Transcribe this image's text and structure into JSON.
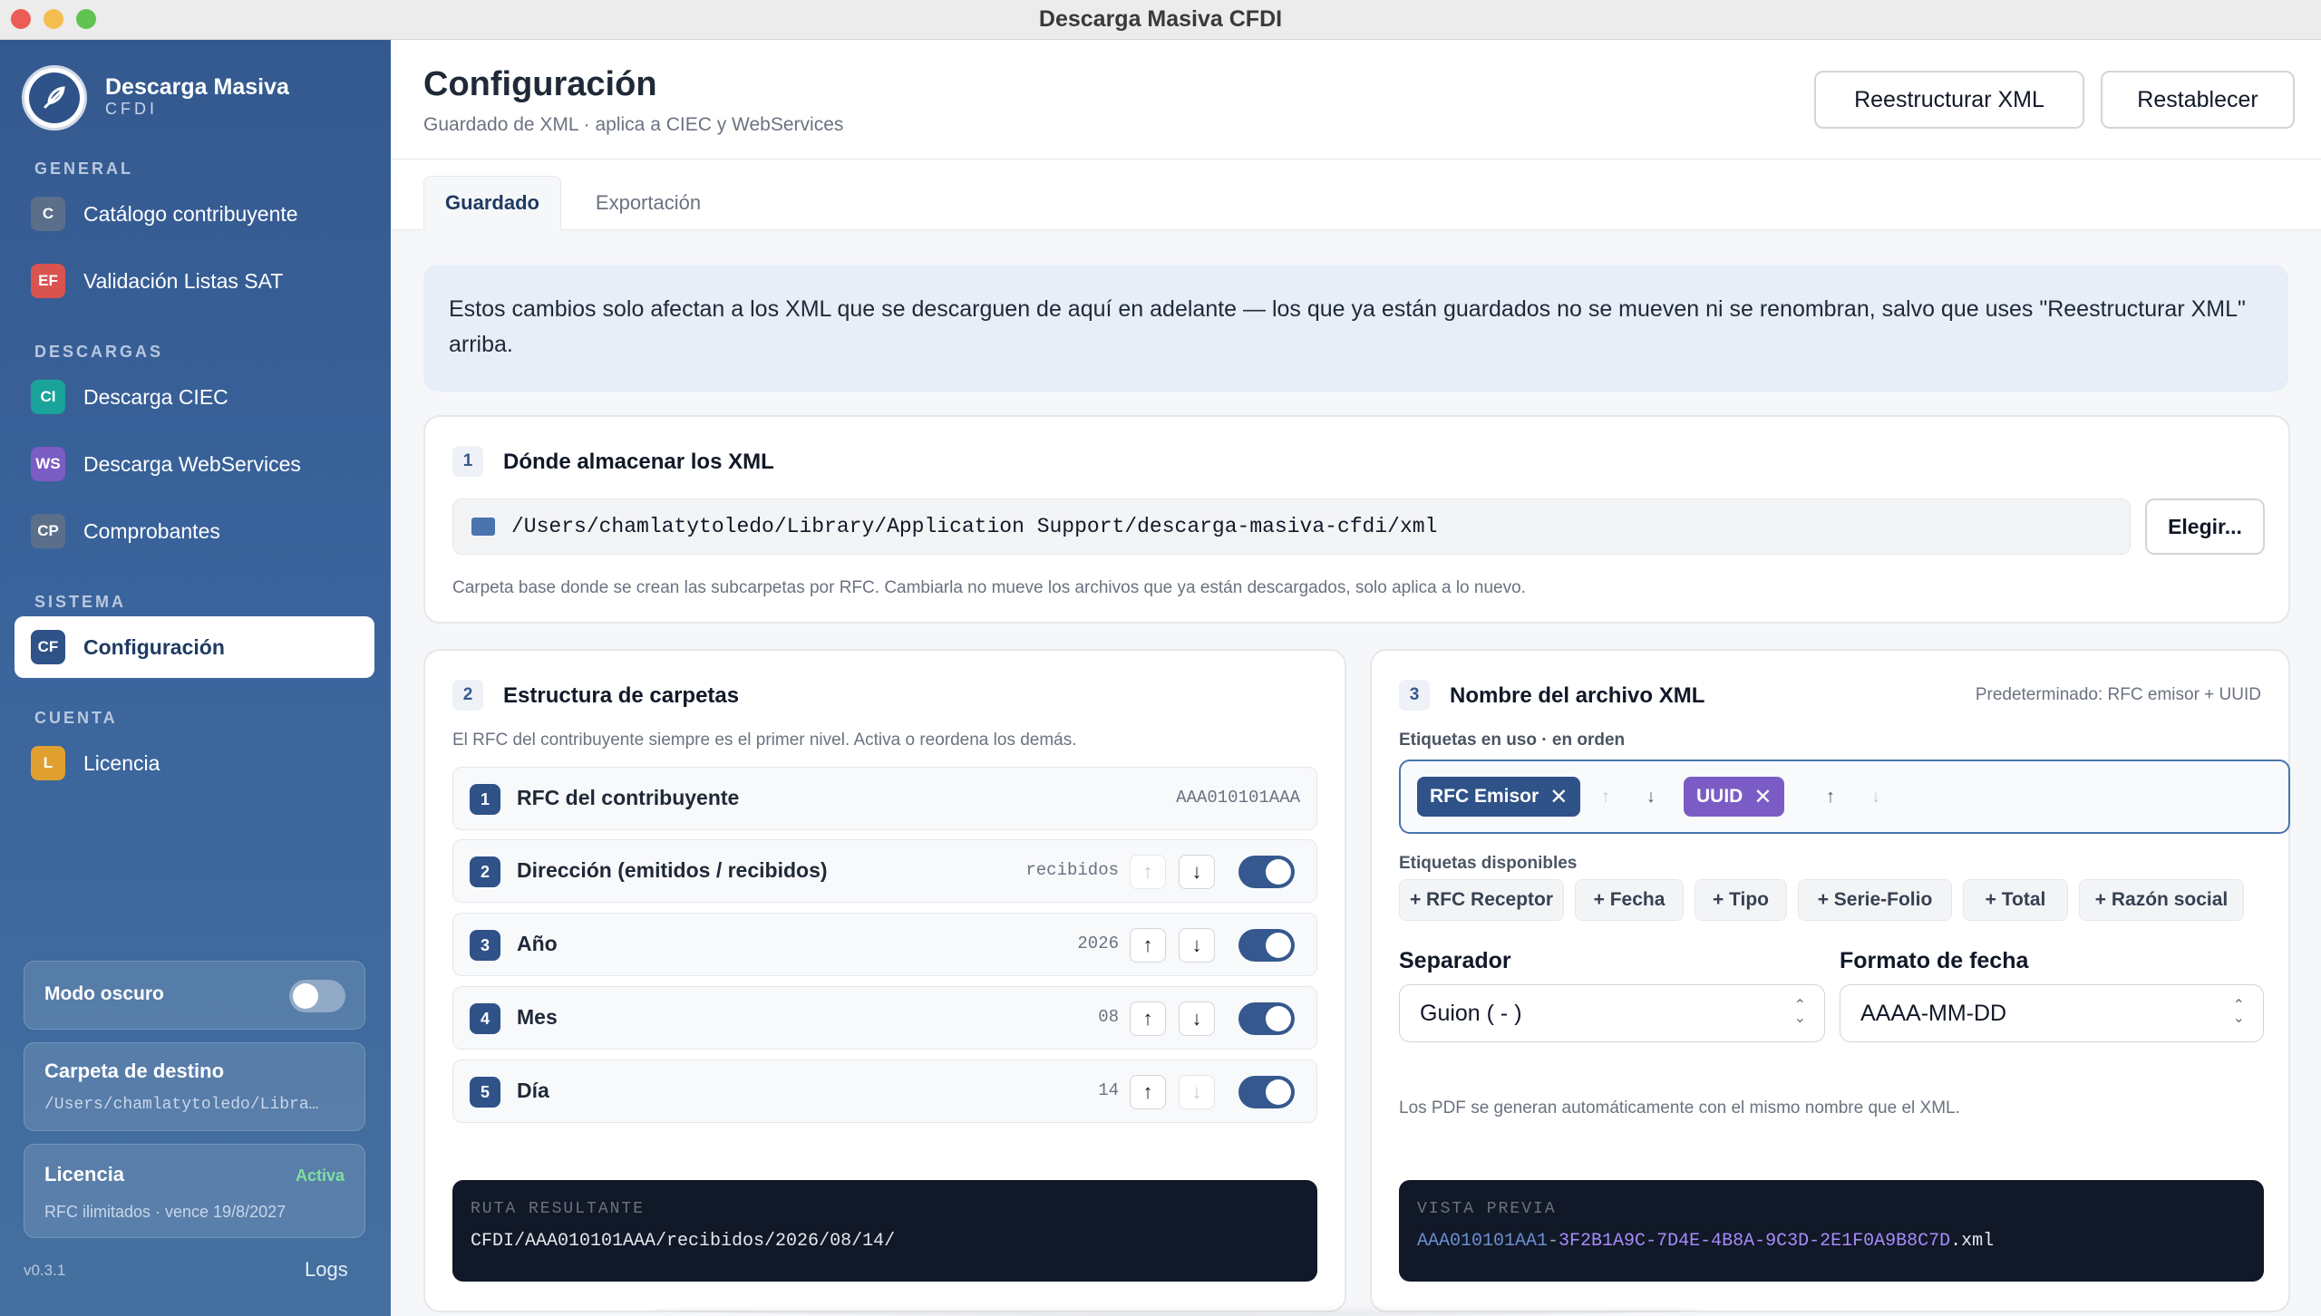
{
  "window": {
    "title": "Descarga Masiva CFDI"
  },
  "brand": {
    "name": "Descarga Masiva",
    "sub": "CFDI"
  },
  "sidebar": {
    "sections": [
      {
        "label": "GENERAL"
      },
      {
        "label": "DESCARGAS"
      },
      {
        "label": "SISTEMA"
      },
      {
        "label": "CUENTA"
      }
    ],
    "items": [
      {
        "badge": "C",
        "label": "Catálogo contribuyente",
        "color": "#5b6f8a"
      },
      {
        "badge": "EF",
        "label": "Validación Listas SAT",
        "color": "#d9534f"
      },
      {
        "badge": "CI",
        "label": "Descarga CIEC",
        "color": "#1aa39a"
      },
      {
        "badge": "WS",
        "label": "Descarga WebServices",
        "color": "#7b5cc4"
      },
      {
        "badge": "CP",
        "label": "Comprobantes",
        "color": "#5b6f8a"
      },
      {
        "badge": "CF",
        "label": "Configuración",
        "color": "#2f5288"
      },
      {
        "badge": "L",
        "label": "Licencia",
        "color": "#e0a030"
      }
    ],
    "dark_mode": {
      "label": "Modo oscuro",
      "on": false
    },
    "destination": {
      "title": "Carpeta de destino",
      "path": "/Users/chamlatytoledo/Libra…"
    },
    "license": {
      "title": "Licencia",
      "status": "Activa",
      "detail": "RFC ilimitados · vence 19/8/2027"
    },
    "version": "v0.3.1",
    "logs": "Logs"
  },
  "header": {
    "title": "Configuración",
    "subtitle": "Guardado de XML · aplica a CIEC y WebServices",
    "restructure": "Reestructurar XML",
    "reset": "Restablecer"
  },
  "tabs": [
    {
      "label": "Guardado"
    },
    {
      "label": "Exportación"
    }
  ],
  "notice": "Estos cambios solo afectan a los XML que se descarguen de aquí en adelante — los que ya están guardados no se mueven ni se renombran, salvo que uses \"Reestructurar XML\" arriba.",
  "storage": {
    "num": "1",
    "title": "Dónde almacenar los XML",
    "path": "/Users/chamlatytoledo/Library/Application Support/descarga-masiva-cfdi/xml",
    "choose": "Elegir...",
    "help": "Carpeta base donde se crean las subcarpetas por RFC. Cambiarla no mueve los archivos que ya están descargados, solo aplica a lo nuevo."
  },
  "folders": {
    "num": "2",
    "title": "Estructura de carpetas",
    "help": "El RFC del contribuyente siempre es el primer nivel. Activa o reordena los demás.",
    "rows": [
      {
        "n": "1",
        "label": "RFC del contribuyente",
        "value": "AAA010101AAA"
      },
      {
        "n": "2",
        "label": "Dirección (emitidos / recibidos)",
        "value": "recibidos"
      },
      {
        "n": "3",
        "label": "Año",
        "value": "2026"
      },
      {
        "n": "4",
        "label": "Mes",
        "value": "08"
      },
      {
        "n": "5",
        "label": "Día",
        "value": "14"
      }
    ],
    "result_label": "RUTA RESULTANTE",
    "result": "CFDI/AAA010101AAA/recibidos/2026/08/14/"
  },
  "filename": {
    "num": "3",
    "title": "Nombre del archivo XML",
    "default": "Predeterminado: RFC emisor + UUID",
    "in_use_label": "Etiquetas en uso · en orden",
    "in_use": [
      {
        "label": "RFC Emisor",
        "color": "#2f5288"
      },
      {
        "label": "UUID",
        "color": "#7b5cc4"
      }
    ],
    "available_label": "Etiquetas disponibles",
    "available": [
      "+ RFC Receptor",
      "+ Fecha",
      "+ Tipo",
      "+ Serie-Folio",
      "+ Total",
      "+ Razón social"
    ],
    "separator_label": "Separador",
    "separator": "Guion ( - )",
    "date_label": "Formato de fecha",
    "date_format": "AAAA-MM-DD",
    "pdf_note": "Los PDF se generan automáticamente con el mismo nombre que el XML.",
    "preview_label": "VISTA PREVIA",
    "preview_rfc": "AAA010101AA1",
    "preview_sep": "-",
    "preview_uuid": "3F2B1A9C-7D4E-4B8A-9C3D-2E1F0A9B8C7D",
    "preview_ext": ".xml"
  },
  "icons": {
    "close": "x-icon",
    "up": "arrow-up-icon",
    "down": "arrow-down-icon",
    "folder": "folder-icon",
    "logo": "feather-logo-icon"
  }
}
